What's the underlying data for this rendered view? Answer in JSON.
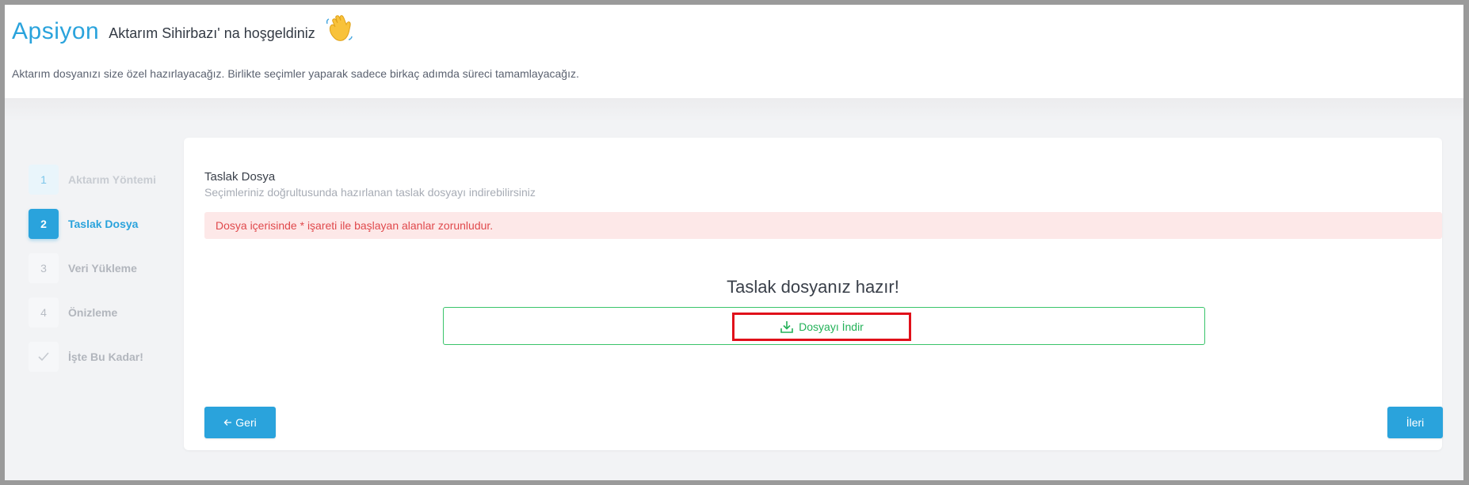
{
  "header": {
    "brand": "Apsiyon",
    "welcome": "Aktarım Sihirbazı' na hoşgeldiniz",
    "wave_icon": "waving-hand-emoji",
    "subtitle": "Aktarım dosyanızı size özel hazırlayacağız. Birlikte seçimler yaparak sadece birkaç adımda süreci tamamlayacağız."
  },
  "steps": [
    {
      "num": "1",
      "label": "Aktarım Yöntemi",
      "state": "done"
    },
    {
      "num": "2",
      "label": "Taslak Dosya",
      "state": "active"
    },
    {
      "num": "3",
      "label": "Veri Yükleme",
      "state": "pending"
    },
    {
      "num": "4",
      "label": "Önizleme",
      "state": "pending"
    },
    {
      "num": "",
      "label": "İşte Bu Kadar!",
      "state": "pending",
      "icon": "check-icon"
    }
  ],
  "card": {
    "title": "Taslak Dosya",
    "subtitle": "Seçimleriniz doğrultusunda hazırlanan taslak dosyayı indirebilirsiniz",
    "alert": "Dosya içerisinde * işareti ile başlayan alanlar zorunludur.",
    "ready_text": "Taslak dosyanız hazır!",
    "download_label": "Dosyayı İndir",
    "download_icon": "download-icon",
    "back_label": "Geri",
    "back_icon": "arrow-left-icon",
    "next_label": "İleri"
  },
  "colors": {
    "brand": "#2aa3dc",
    "success": "#39c46a",
    "danger": "#e0494c",
    "alert_bg": "#fde8e8"
  }
}
